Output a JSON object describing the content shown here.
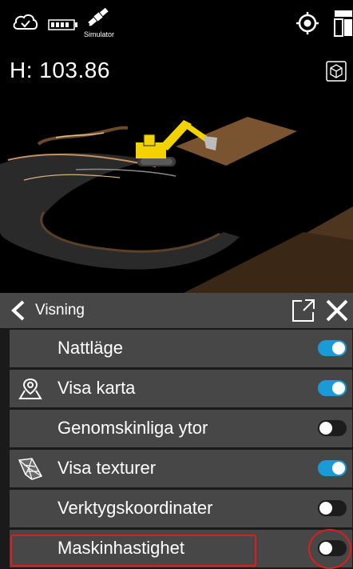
{
  "status_bar": {
    "simulator_label": "Simulator",
    "icons": [
      "cloud-check-icon",
      "battery-icon",
      "satellite-icon",
      "target-icon",
      "layers-icon"
    ]
  },
  "viewport": {
    "height_readout": "H: 103.86",
    "view_cube_icon": "cube-icon"
  },
  "panel": {
    "title": "Visning",
    "header_icons": [
      "back-chevron-icon",
      "popout-icon",
      "close-icon"
    ],
    "toggle_on_color": "#1a9ad6",
    "highlight_color": "#e01c1c",
    "items": [
      {
        "label": "Nattläge",
        "icon": "",
        "enabled": true
      },
      {
        "label": "Visa karta",
        "icon": "map-pin-icon",
        "enabled": true
      },
      {
        "label": "Genomskinliga ytor",
        "icon": "",
        "enabled": false
      },
      {
        "label": "Visa texturer",
        "icon": "texture-mesh-icon",
        "enabled": true
      },
      {
        "label": "Verktygskoordinater",
        "icon": "",
        "enabled": false
      },
      {
        "label": "Maskinhastighet",
        "icon": "",
        "enabled": false
      }
    ]
  }
}
